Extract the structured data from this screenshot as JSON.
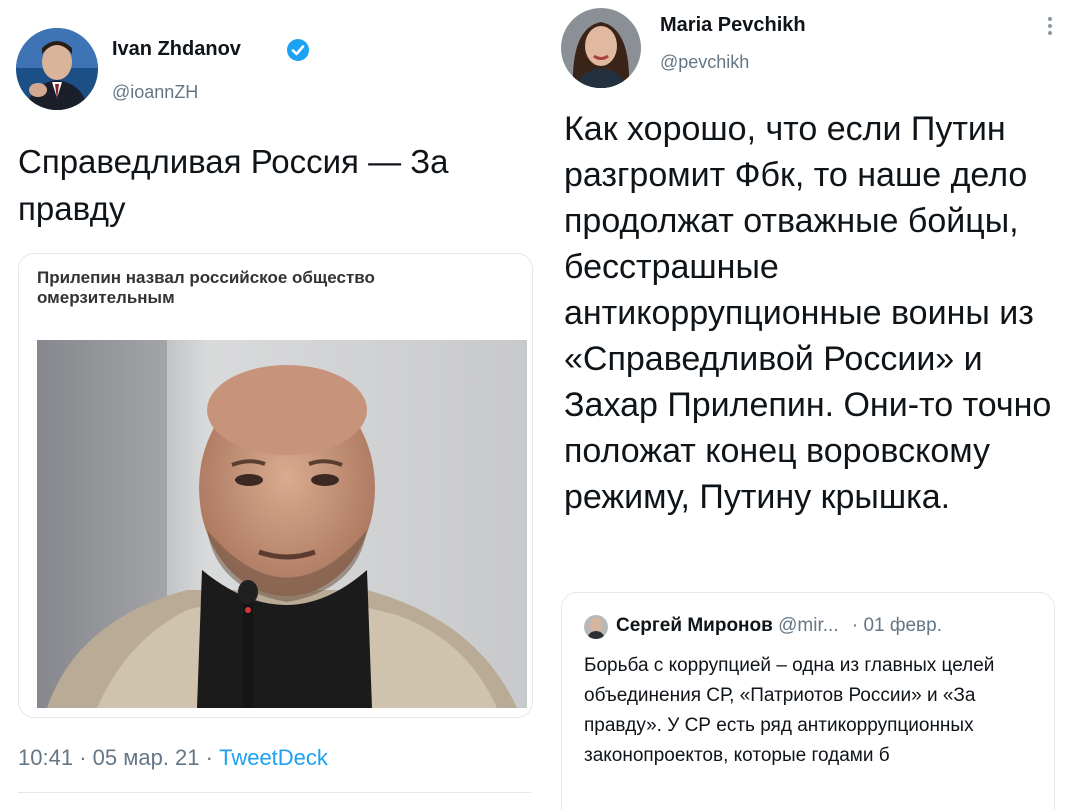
{
  "left_tweet": {
    "author_name": "Ivan Zhdanov",
    "author_handle": "@ioannZH",
    "text": "Справедливая Россия — За правду",
    "card": {
      "headline": "Прилепин назвал российское общество омерзительным"
    },
    "meta": {
      "time": "10:41",
      "sep1": "·",
      "date": "05 мар. 21",
      "sep2": "·",
      "source": "TweetDeck"
    }
  },
  "right_tweet": {
    "author_name": "Maria Pevchikh",
    "author_handle": "@pevchikh",
    "more_icon": "more-vertical-icon",
    "text": "Как хорошо, что если Путин разгромит Фбк, то наше дело продолжат отважные бойцы, бесстрашные антикоррупционные воины из «Справедливой России» и Захар Прилепин. Они-то точно положат конец воровскому режиму, Путину крышка.",
    "quoted": {
      "author_name": "Сергей Миронов",
      "author_handle": "@mir...",
      "date": "· 01 февр.",
      "text": "Борьба с коррупцией – одна из главных целей объединения СР, «Патриотов России» и «За правду». У СР есть ряд антикоррупционных законопроектов, которые годами б"
    }
  },
  "colors": {
    "verified": "#1da1f2",
    "link": "#1da1f2",
    "secondary_text": "#657786"
  }
}
